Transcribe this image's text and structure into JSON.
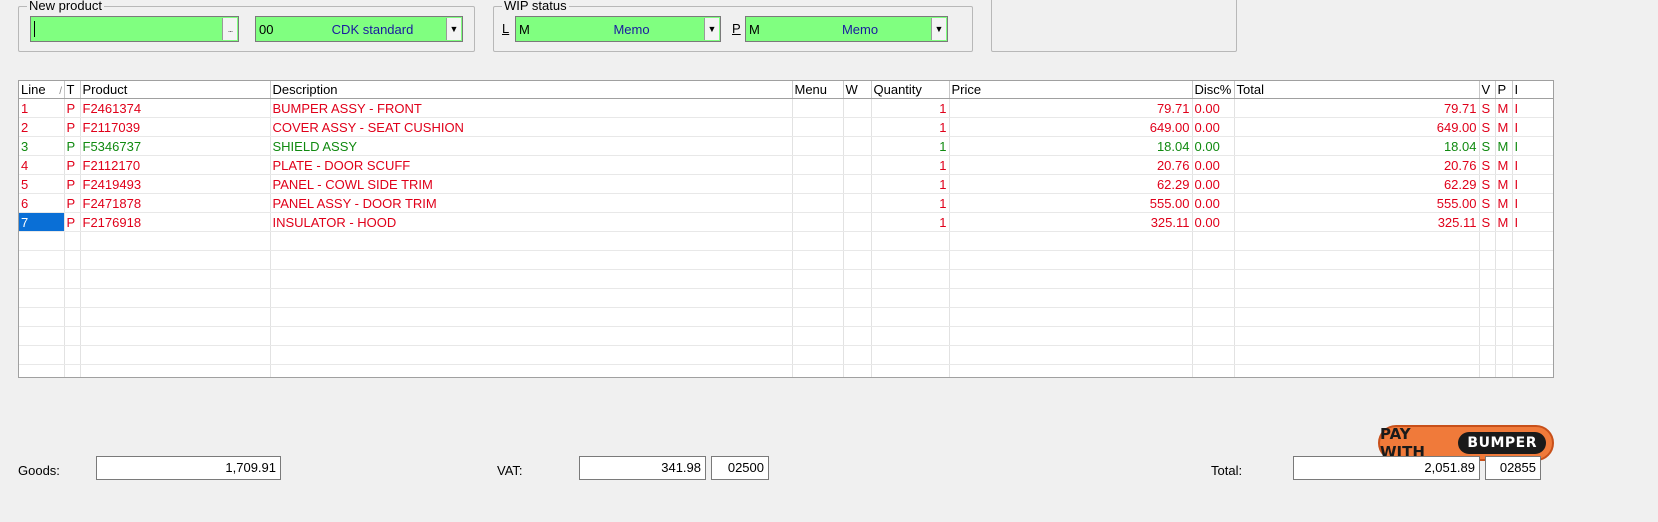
{
  "new_product": {
    "legend": "New product",
    "product_value": "",
    "ellipsis": "...",
    "type_code": "00",
    "type_label": "CDK standard"
  },
  "wip_status": {
    "legend": "WIP status",
    "l_label": "L",
    "l_code": "M",
    "l_value": "Memo",
    "p_label": "P",
    "p_code": "M",
    "p_value": "Memo"
  },
  "grid": {
    "columns": [
      "Line",
      "T",
      "Product",
      "Description",
      "Menu",
      "W",
      "Quantity",
      "Price",
      "Disc%",
      "Total",
      "V",
      "P",
      "I"
    ],
    "sort_indicator": "/",
    "rows": [
      {
        "line": "1",
        "t": "P",
        "product": "F2461374",
        "description": "BUMPER ASSY - FRONT",
        "menu": "",
        "w": "",
        "quantity": "1",
        "price": "79.71",
        "disc": "0.00",
        "total": "79.71",
        "v": "S",
        "p": "M",
        "i": "I",
        "color": "red"
      },
      {
        "line": "2",
        "t": "P",
        "product": "F2117039",
        "description": "COVER ASSY - SEAT CUSHION",
        "menu": "",
        "w": "",
        "quantity": "1",
        "price": "649.00",
        "disc": "0.00",
        "total": "649.00",
        "v": "S",
        "p": "M",
        "i": "I",
        "color": "red"
      },
      {
        "line": "3",
        "t": "P",
        "product": "F5346737",
        "description": "SHIELD ASSY",
        "menu": "",
        "w": "",
        "quantity": "1",
        "price": "18.04",
        "disc": "0.00",
        "total": "18.04",
        "v": "S",
        "p": "M",
        "i": "I",
        "color": "green"
      },
      {
        "line": "4",
        "t": "P",
        "product": "F2112170",
        "description": "PLATE - DOOR SCUFF",
        "menu": "",
        "w": "",
        "quantity": "1",
        "price": "20.76",
        "disc": "0.00",
        "total": "20.76",
        "v": "S",
        "p": "M",
        "i": "I",
        "color": "red"
      },
      {
        "line": "5",
        "t": "P",
        "product": "F2419493",
        "description": "PANEL - COWL SIDE TRIM",
        "menu": "",
        "w": "",
        "quantity": "1",
        "price": "62.29",
        "disc": "0.00",
        "total": "62.29",
        "v": "S",
        "p": "M",
        "i": "I",
        "color": "red"
      },
      {
        "line": "6",
        "t": "P",
        "product": "F2471878",
        "description": "PANEL ASSY - DOOR TRIM",
        "menu": "",
        "w": "",
        "quantity": "1",
        "price": "555.00",
        "disc": "0.00",
        "total": "555.00",
        "v": "S",
        "p": "M",
        "i": "I",
        "color": "red"
      },
      {
        "line": "7",
        "t": "P",
        "product": "F2176918",
        "description": "INSULATOR - HOOD",
        "menu": "",
        "w": "",
        "quantity": "1",
        "price": "325.11",
        "disc": "0.00",
        "total": "325.11",
        "v": "S",
        "p": "M",
        "i": "I",
        "color": "red",
        "selected": true
      }
    ],
    "empty_rows": 8
  },
  "pay_button": {
    "prefix": "PAY WITH",
    "brand": "BUMPER"
  },
  "totals": {
    "goods_label": "Goods:",
    "goods_value": "1,709.91",
    "vat_label": "VAT:",
    "vat_value": "341.98",
    "vat_code": "02500",
    "total_label": "Total:",
    "total_value": "2,051.89",
    "total_code": "02855"
  },
  "colors": {
    "field_green": "#80ff80",
    "line_red": "#e0001a",
    "line_green": "#108a10",
    "selection_blue": "#0a6fd6",
    "pay_orange": "#f07a3a"
  }
}
